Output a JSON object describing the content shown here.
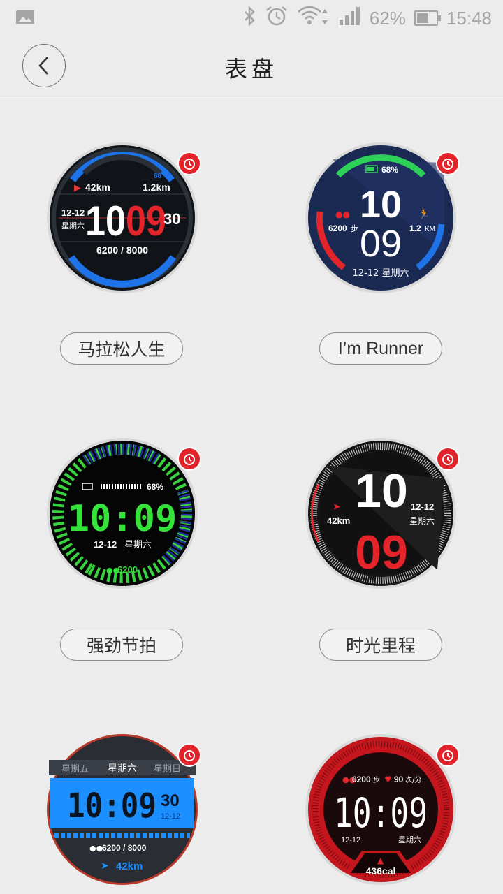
{
  "status_bar": {
    "battery": "62%",
    "battery_level": 0.62,
    "time": "15:48"
  },
  "header": {
    "title": "表盘"
  },
  "faces": [
    {
      "name": "马拉松人生",
      "distance_run": "42km",
      "distance_today": "1.2km",
      "date": "12-12",
      "weekday": "星期六",
      "hour": "10",
      "minute": "09",
      "second": "30",
      "steps": "6200 / 8000",
      "battery": "68"
    },
    {
      "name": "I’m Runner",
      "battery": "68%",
      "hour": "10",
      "minute": "09",
      "steps": "6200",
      "steps_unit": "步",
      "distance": "1.2",
      "distance_unit": "KM",
      "date": "12-12 星期六"
    },
    {
      "name": "强劲节拍",
      "battery": "68%",
      "time": "10:09",
      "date": "12-12",
      "weekday": "星期六",
      "steps": "6200"
    },
    {
      "name": "时光里程",
      "hour": "10",
      "minute": "09",
      "distance": "42km",
      "date": "12-12",
      "weekday": "星期六"
    },
    {
      "name": "",
      "day_prev": "星期五",
      "day_current": "星期六",
      "day_next": "星期日",
      "time": "10:09",
      "second": "30",
      "date": "12-12",
      "steps": "6200 / 8000",
      "distance": "42km"
    },
    {
      "name": "",
      "steps": "6200",
      "steps_unit": "步",
      "heart_rate": "90",
      "heart_rate_unit": "次/分",
      "time": "10:09",
      "date": "12-12",
      "weekday": "星期六",
      "calories": "436cal"
    }
  ]
}
